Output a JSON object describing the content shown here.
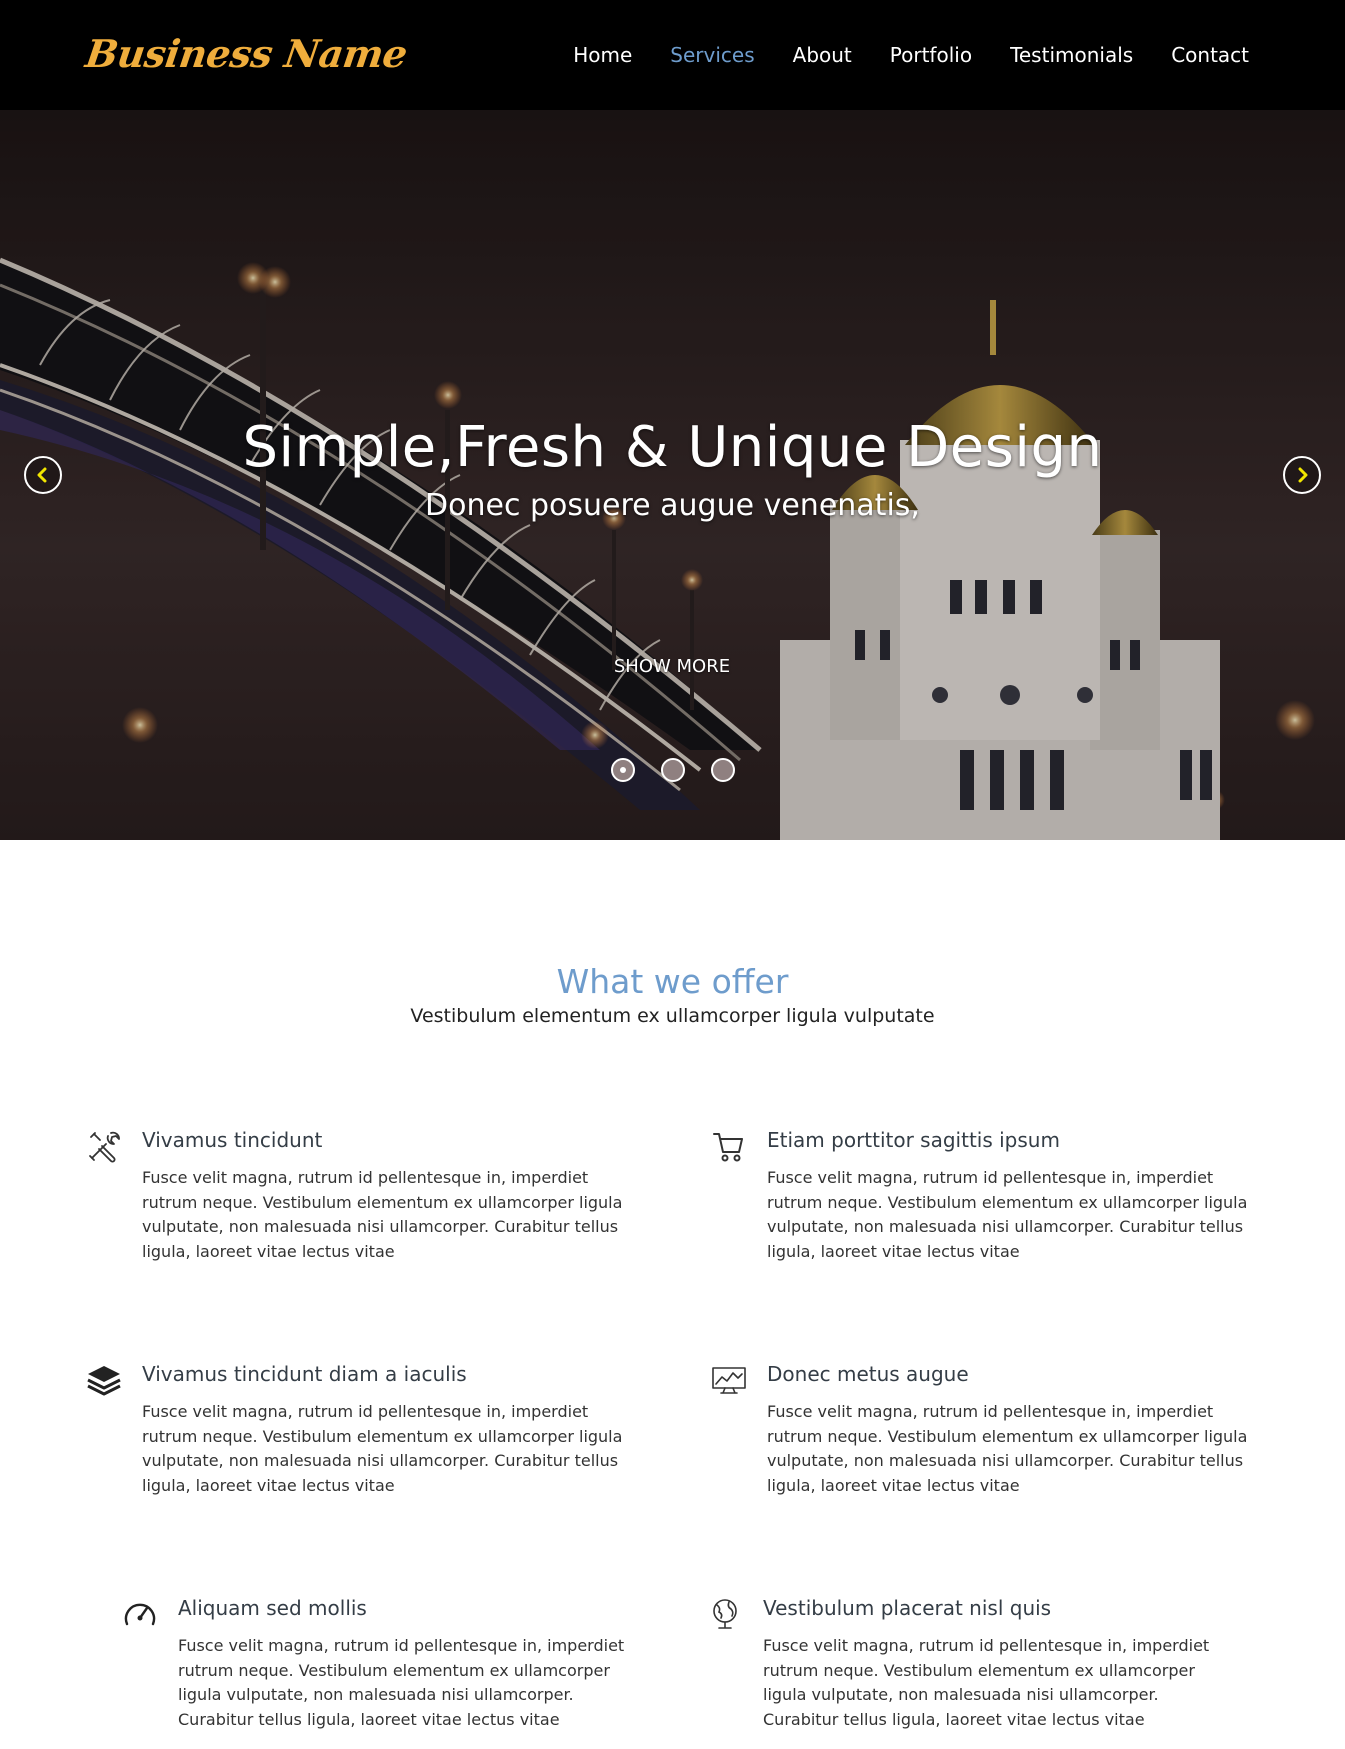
{
  "header": {
    "logo": "Business Name",
    "nav": [
      "Home",
      "Services",
      "About",
      "Portfolio",
      "Testimonials",
      "Contact"
    ],
    "active_nav": "Services"
  },
  "hero": {
    "title": "Simple,Fresh & Unique Design",
    "subtitle": "Donec posuere augue venenatis,",
    "cta": "SHOW MORE",
    "slides_count": 3,
    "active_slide": 1
  },
  "offer": {
    "title": "What we offer",
    "subtitle": "Vestibulum elementum ex ullamcorper ligula vulputate",
    "features": [
      {
        "icon": "tools-icon",
        "title": "Vivamus tincidunt",
        "text": "Fusce velit magna, rutrum id pellentesque in, imperdiet rutrum neque. Vestibulum elementum ex ullamcorper ligula vulputate, non malesuada nisi ullamcorper. Curabitur tellus ligula, laoreet vitae lectus vitae"
      },
      {
        "icon": "cart-icon",
        "title": "Etiam porttitor sagittis ipsum",
        "text": "Fusce velit magna, rutrum id pellentesque in, imperdiet rutrum neque. Vestibulum elementum ex ullamcorper ligula vulputate, non malesuada nisi ullamcorper. Curabitur tellus ligula, laoreet vitae lectus vitae"
      },
      {
        "icon": "layers-icon",
        "title": "Vivamus tincidunt diam a iaculis",
        "text": "Fusce velit magna, rutrum id pellentesque in, imperdiet rutrum neque. Vestibulum elementum ex ullamcorper ligula vulputate, non malesuada nisi ullamcorper. Curabitur tellus ligula, laoreet vitae lectus vitae"
      },
      {
        "icon": "monitor-chart-icon",
        "title": "Donec metus augue",
        "text": "Fusce velit magna, rutrum id pellentesque in, imperdiet rutrum neque. Vestibulum elementum ex ullamcorper ligula vulputate, non malesuada nisi ullamcorper. Curabitur tellus ligula, laoreet vitae lectus vitae"
      },
      {
        "icon": "speedometer-icon",
        "title": "Aliquam sed mollis",
        "text": "Fusce velit magna, rutrum id pellentesque in, imperdiet rutrum neque. Vestibulum elementum ex ullamcorper ligula vulputate, non malesuada nisi ullamcorper. Curabitur tellus ligula, laoreet vitae lectus vitae"
      },
      {
        "icon": "globe-icon",
        "title": "Vestibulum placerat nisl quis",
        "text": "Fusce velit magna, rutrum id pellentesque in, imperdiet rutrum neque. Vestibulum elementum ex ullamcorper ligula vulputate, non malesuada nisi ullamcorper. Curabitur tellus ligula, laoreet vitae lectus vitae"
      }
    ]
  },
  "colors": {
    "header_bg": "#000000",
    "logo": "#efad3c",
    "accent": "#6e9ccc",
    "arrow_chevron": "#f2e600",
    "heading_text": "#343d46"
  }
}
